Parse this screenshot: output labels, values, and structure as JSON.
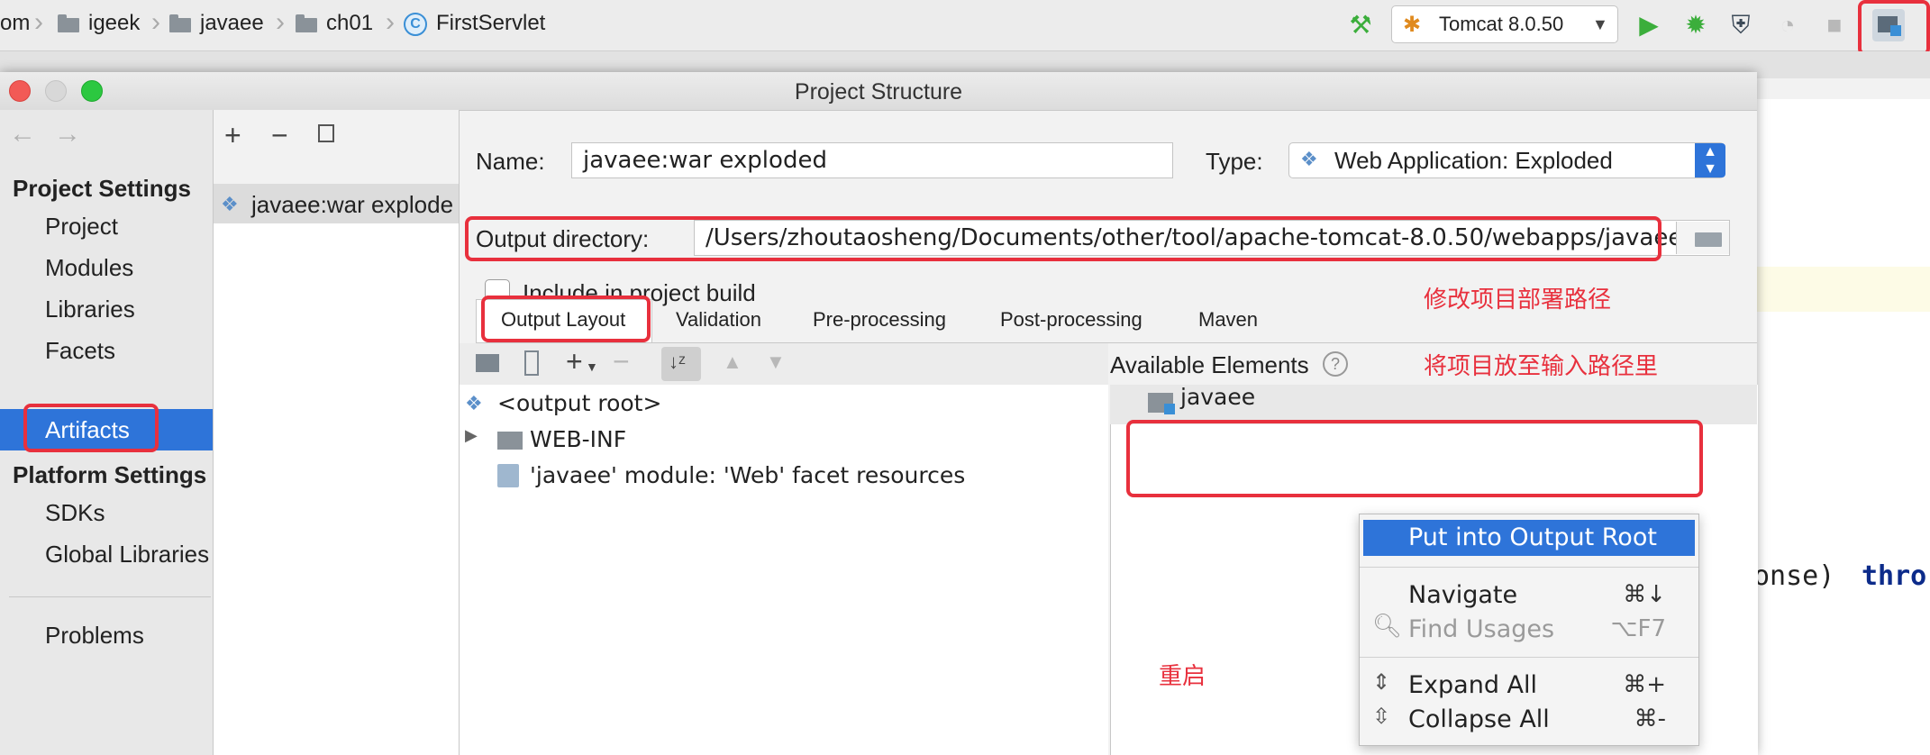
{
  "breadcrumb": {
    "items": [
      "om",
      "igeek",
      "javaee",
      "ch01",
      "FirstServlet"
    ],
    "class_badge": "C"
  },
  "run": {
    "config_label": "Tomcat 8.0.50"
  },
  "dialog": {
    "title": "Project Structure"
  },
  "sidebar": {
    "project_settings_header": "Project Settings",
    "project_items": [
      "Project",
      "Modules",
      "Libraries",
      "Facets",
      "Artifacts"
    ],
    "platform_settings_header": "Platform Settings",
    "platform_items": [
      "SDKs",
      "Global Libraries"
    ],
    "problems": "Problems"
  },
  "artifacts": {
    "items": [
      "javaee:war explode"
    ]
  },
  "form": {
    "name_label": "Name:",
    "name_value": "javaee:war exploded",
    "type_label": "Type:",
    "type_value": "Web Application: Exploded",
    "output_dir_label": "Output directory:",
    "output_dir_value": "/Users/zhoutaosheng/Documents/other/tool/apache-tomcat-8.0.50/webapps/javaee",
    "include_label": "Include in project build",
    "include_checked": false
  },
  "tabs": [
    "Output Layout",
    "Validation",
    "Pre-processing",
    "Post-processing",
    "Maven"
  ],
  "layout_tree": [
    "<output root>",
    "WEB-INF",
    "'javaee' module: 'Web' facet resources"
  ],
  "available": {
    "header": "Available Elements",
    "help": "?",
    "items": [
      "javaee"
    ]
  },
  "context_menu": {
    "items": [
      {
        "label": "Put into Output Root",
        "shortcut": ""
      },
      {
        "label": "Navigate",
        "shortcut": "⌘↓"
      },
      {
        "label": "Find Usages",
        "shortcut": "⌥F7"
      },
      {
        "label": "Expand All",
        "shortcut": "⌘+"
      },
      {
        "label": "Collapse All",
        "shortcut": "⌘-"
      }
    ]
  },
  "annotations": {
    "modify_path": "修改项目部署路径",
    "put_into_output": "将项目放至输入路径里",
    "restart": "重启"
  },
  "editor_fragment": {
    "text": "onse)",
    "keyword": "thro"
  },
  "colors": {
    "selection_blue": "#2e74d9",
    "annotation_red": "#e8303d",
    "run_green": "#3bae3b"
  }
}
